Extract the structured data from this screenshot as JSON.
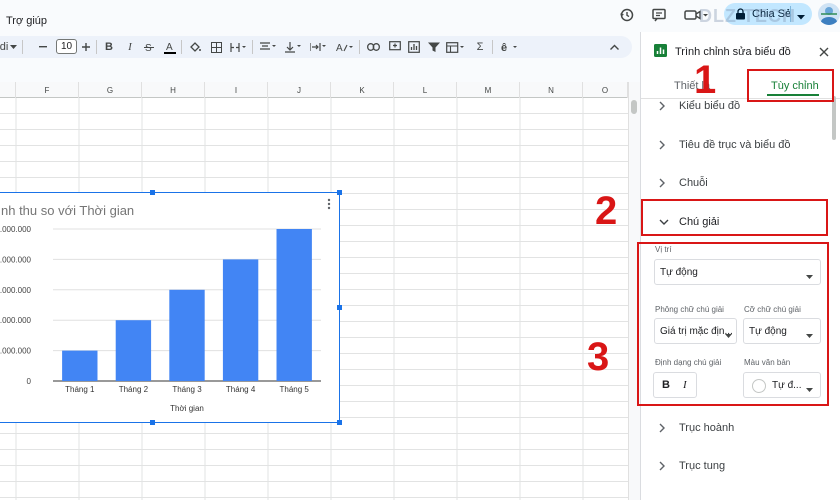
{
  "menu": {
    "help": "Trợ giúp"
  },
  "header": {
    "share_label": "Chia Sẻ",
    "watermark": "DLZ TECH"
  },
  "toolbar": {
    "font_size": "10",
    "partial_left": "di",
    "sigma": "Σ"
  },
  "sheet": {
    "columns": [
      "F",
      "G",
      "H",
      "I",
      "J",
      "K",
      "L",
      "M",
      "N",
      "O"
    ]
  },
  "chart_data": {
    "type": "bar",
    "title": "nh thu so với Thời gian",
    "categories": [
      "Tháng 1",
      "Tháng 2",
      "Tháng 3",
      "Tháng 4",
      "Tháng 5"
    ],
    "values": [
      2,
      4,
      6,
      8,
      10
    ],
    "xlabel": "Thời gian",
    "ylabel": "",
    "ylim": [
      0,
      10
    ],
    "ytick_values": [
      0,
      2,
      4,
      6,
      8,
      10
    ],
    "ytick_labels": [
      "0",
      "00.000.000",
      "00.000.000",
      "00.000.000",
      "00.000.000",
      "00.000.000"
    ],
    "bar_color": "#4285f4",
    "grid": true
  },
  "panel": {
    "title": "Trình chỉnh sửa biểu đồ",
    "tab_setup": "Thiết lậ",
    "tab_custom": "Tùy chỉnh",
    "sections": {
      "chart_style": "Kiểu biểu đồ",
      "axis_titles": "Tiêu đề trục và biểu đồ",
      "series": "Chuỗi",
      "legend": "Chú giải",
      "h_axis": "Trục hoành",
      "v_axis": "Trục tung"
    },
    "legend": {
      "position_label": "Vị trí",
      "position_value": "Tự động",
      "font_label": "Phông chữ chú giải",
      "font_value": "Giá trị mặc địn...",
      "size_label": "Cỡ chữ chú giải",
      "size_value": "Tự động",
      "format_label": "Định dạng chú giải",
      "bold": "B",
      "italic": "I",
      "color_label": "Màu văn bản",
      "color_value": "Tự đ..."
    }
  },
  "annotations": {
    "n1": "1",
    "n2": "2",
    "n3": "3"
  },
  "colors": {
    "accent_green": "#188038",
    "annotation_red": "#d91616",
    "selection_blue": "#1a73e8"
  }
}
